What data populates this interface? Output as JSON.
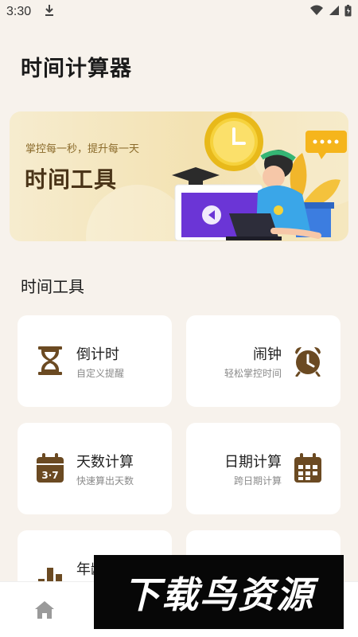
{
  "status_bar": {
    "time": "3:30"
  },
  "header": {
    "title": "时间计算器"
  },
  "banner": {
    "subtitle": "掌控每一秒，提升每一天",
    "title": "时间工具"
  },
  "section": {
    "title": "时间工具"
  },
  "cards": [
    {
      "title": "倒计时",
      "desc": "自定义提醒",
      "icon": "hourglass-icon"
    },
    {
      "title": "闹钟",
      "desc": "轻松掌控时间",
      "icon": "alarm-clock-icon"
    },
    {
      "title": "天数计算",
      "desc": "快速算出天数",
      "icon": "calendar-37-icon"
    },
    {
      "title": "日期计算",
      "desc": "跨日期计算",
      "icon": "calendar-grid-icon"
    },
    {
      "title": "年龄",
      "icon": "bar-chart-icon"
    }
  ],
  "bottom_nav": {
    "items": [
      {
        "icon": "home-icon"
      }
    ]
  },
  "watermark": {
    "text": "下载鸟资源"
  },
  "colors": {
    "background": "#f7f2ec",
    "accent": "#6b4a22",
    "card": "#ffffff"
  }
}
